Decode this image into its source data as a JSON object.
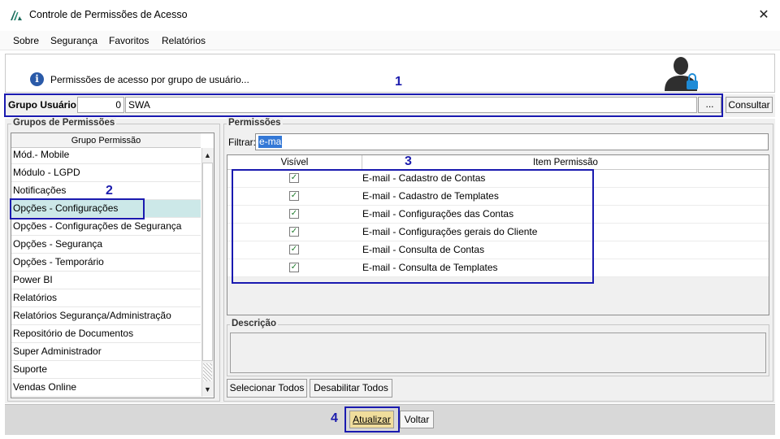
{
  "window": {
    "title": "Controle de Permissões de Acesso",
    "close_glyph": "✕"
  },
  "menu": [
    "Sobre",
    "Segurança",
    "Favoritos",
    "Relatórios"
  ],
  "header": {
    "info_text": "Permissões de acesso por grupo de usuário...",
    "icon": "info-icon",
    "image": "user-lock-icon"
  },
  "group_user": {
    "label": "Grupo Usuário:",
    "code": "0",
    "name": "SWA",
    "dots_label": "...",
    "consultar_label": "Consultar"
  },
  "permission_groups": {
    "title": "Grupos de Permissões",
    "column_header": "Grupo Permissão",
    "items": [
      "Mód.- Mobile",
      "Módulo - LGPD",
      "Notificações",
      "Opções - Configurações",
      "Opções - Configurações de Segurança",
      "Opções - Segurança",
      "Opções - Temporário",
      "Power BI",
      "Relatórios",
      "Relatórios Segurança/Administração",
      "Repositório de Documentos",
      "Super Administrador",
      "Suporte",
      "Vendas Online"
    ],
    "selected": "Opções - Configurações"
  },
  "permissions": {
    "title": "Permissões",
    "filter_label": "Filtrar:",
    "filter_value": "e-ma",
    "columns": [
      "Visível",
      "Item Permissão"
    ],
    "rows": [
      {
        "visible": true,
        "item": "E-mail - Cadastro de Contas"
      },
      {
        "visible": true,
        "item": "E-mail - Cadastro de Templates"
      },
      {
        "visible": true,
        "item": "E-mail - Configurações das Contas"
      },
      {
        "visible": true,
        "item": "E-mail - Configurações gerais do Cliente"
      },
      {
        "visible": true,
        "item": "E-mail - Consulta de Contas"
      },
      {
        "visible": true,
        "item": "E-mail - Consulta de Templates"
      }
    ],
    "description_title": "Descrição",
    "description_value": "",
    "select_all_label": "Selecionar Todos",
    "disable_all_label": "Desabilitar Todos"
  },
  "footer": {
    "update_label": "Atualizar",
    "back_label": "Voltar"
  },
  "annotations": [
    "1",
    "2",
    "3",
    "4"
  ],
  "colors": {
    "annotation": "#1a1ab0",
    "selected_row": "#cce8e8",
    "update_button": "#f0dd9c",
    "filter_highlight": "#3478d6"
  }
}
